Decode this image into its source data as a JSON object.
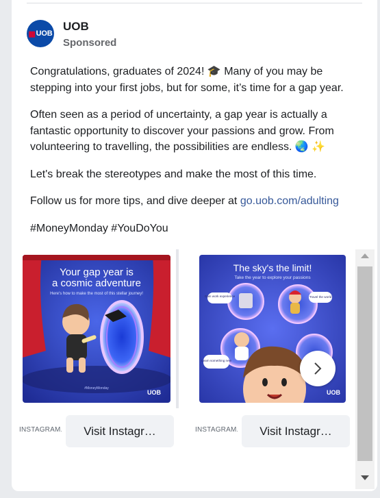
{
  "post": {
    "page_name": "UOB",
    "avatar_text": "UOB",
    "sponsored": "Sponsored",
    "paragraphs": {
      "p1": "Congratulations, graduates of 2024! 🎓  Many of you may be stepping into your first jobs, but for some, it’s time for a gap year.",
      "p2": "Often seen as a period of uncertainty, a gap year is actually a fantastic opportunity to discover your passions and grow. From volunteering to travelling, the possibilities are endless. 🌏 ✨",
      "p3": "Let's break the stereotypes and make the most of this time.",
      "p4_text": "Follow us for more tips, and dive deeper at ",
      "p4_link": "go.uob.com/adulting",
      "p5": "#MoneyMonday #YouDoYou"
    }
  },
  "carousel": {
    "cards": [
      {
        "title_line1": "Your gap year is",
        "title_line2": "a cosmic adventure",
        "subtitle": "Here's how to make the most of this stellar journey!",
        "hashtag": "#MoneyMonday",
        "brand": "UOB",
        "source": "INSTAGRAM.COM",
        "button": "Visit Instagr…"
      },
      {
        "title": "The sky's the limit!",
        "subtitle": "Take the year to explore your passions",
        "bubble1": "Gain work experience",
        "bubble2": "Travel the world",
        "bubble3": "Learn something new",
        "brand": "UOB",
        "source": "INSTAGRAM.COM",
        "button": "Visit Instagr…"
      }
    ]
  },
  "colors": {
    "brand_blue": "#0b4aa8",
    "brand_red": "#e4002b",
    "link": "#365899",
    "card1_bg": "#2d3fb7",
    "card2_bg": "#3b4fc4"
  }
}
